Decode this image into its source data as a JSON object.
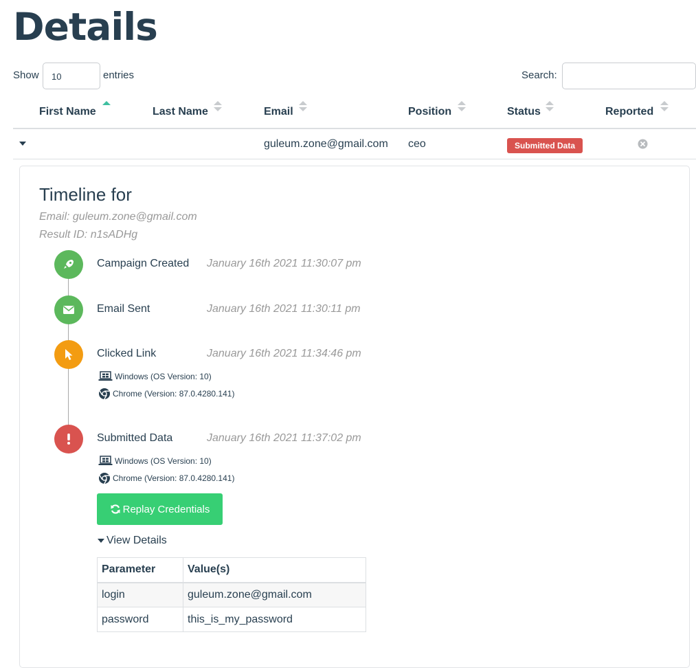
{
  "page": {
    "title": "Details"
  },
  "controls": {
    "show_label": "Show",
    "entries_value": "10",
    "entries_label": "entries",
    "search_label": "Search:",
    "search_value": ""
  },
  "table": {
    "columns": [
      "First Name",
      "Last Name",
      "Email",
      "Position",
      "Status",
      "Reported"
    ],
    "sorted_column": "First Name",
    "row": {
      "first_name": "",
      "last_name": "",
      "email": "guleum.zone@gmail.com",
      "position": "ceo",
      "status": "Submitted Data",
      "status_color": "#d9534f",
      "reported_icon": "times-circle-icon"
    }
  },
  "timeline": {
    "title": "Timeline for",
    "email_line": "Email: guleum.zone@gmail.com",
    "result_line": "Result ID: n1sADHg",
    "events": [
      {
        "name": "Campaign Created",
        "time": "January 16th 2021 11:30:07 pm",
        "icon": "rocket-icon",
        "color": "#5cb85c"
      },
      {
        "name": "Email Sent",
        "time": "January 16th 2021 11:30:11 pm",
        "icon": "envelope-icon",
        "color": "#5cb85c"
      },
      {
        "name": "Clicked Link",
        "time": "January 16th 2021 11:34:46 pm",
        "icon": "mouse-pointer-icon",
        "color": "#f39c12",
        "os": "Windows (OS Version: 10)",
        "browser": "Chrome (Version: 87.0.4280.141)"
      },
      {
        "name": "Submitted Data",
        "time": "January 16th 2021 11:37:02 pm",
        "icon": "exclamation-icon",
        "color": "#d9534f",
        "os": "Windows (OS Version: 10)",
        "browser": "Chrome (Version: 87.0.4280.141)"
      }
    ],
    "replay_button": "Replay Credentials",
    "replay_color": "#37cf74",
    "view_details": "View Details",
    "details_table": {
      "headers": [
        "Parameter",
        "Value(s)"
      ],
      "rows": [
        {
          "param": "login",
          "value": "guleum.zone@gmail.com"
        },
        {
          "param": "password",
          "value": "this_is_my_password"
        }
      ]
    }
  }
}
